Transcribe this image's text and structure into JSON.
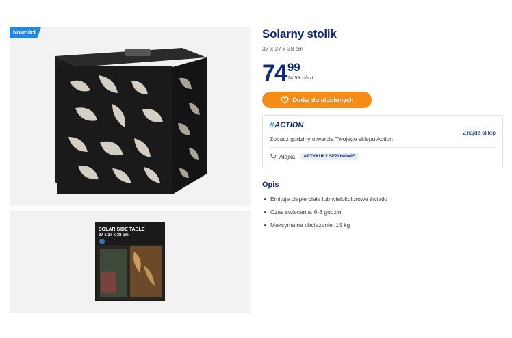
{
  "gallery": {
    "badge": "Nowości",
    "main_image_icon": "solar-table-photo",
    "secondary_image_icon": "product-box-photo",
    "box_text_line1": "SOLAR SIDE TABLE",
    "box_text_line2": "37 x 37 x 38 cm"
  },
  "product": {
    "title": "Solarny stolik",
    "dimensions": "37 x 37 x 38 cm",
    "price_integer": "74",
    "price_decimal": "99",
    "price_unit": "74,99 zł/szt.",
    "favorite_label": "Dodaj do ulubionych",
    "favorite_icon": "heart-icon"
  },
  "store": {
    "logo_text": "ACTION",
    "hours_text": "Zobacz godziny otwarcia Twojego sklepu Action",
    "find_label": "Znajdź sklep",
    "aisle_label": "Alejka:",
    "aisle_value": "ARTYKUŁY SEZONOWE",
    "cart_icon": "cart-icon"
  },
  "description": {
    "title": "Opis",
    "items": [
      "Emituje ciepłe białe lub wielokolorowe światło",
      "Czas świecenia: 6-8 godzin",
      "Maksymalne obciążenie: 15 kg"
    ]
  },
  "colors": {
    "brand_blue": "#0d2b7a",
    "accent_orange": "#f78c14",
    "badge_blue": "#1e88e5"
  }
}
